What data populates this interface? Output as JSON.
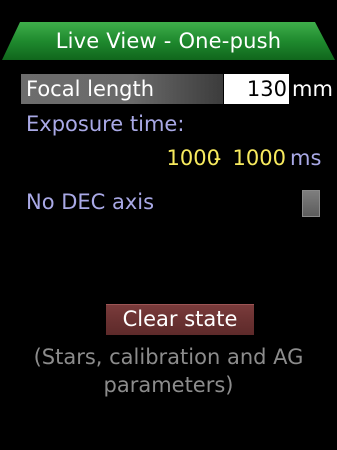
{
  "header": {
    "title": "Live View - One-push",
    "tab_color": "#1f8a2e"
  },
  "focal": {
    "label": "Focal length",
    "value": "130",
    "unit": "mm"
  },
  "exposure": {
    "label": "Exposure time:",
    "min": "1000",
    "separator": "-",
    "max": "1000",
    "unit": "ms",
    "value_color": "#f7ea5e",
    "label_color": "#a9a9e6"
  },
  "dec_axis": {
    "label": "No DEC axis",
    "checked": false
  },
  "actions": {
    "clear_label": "Clear state",
    "clear_hint_line1": "(Stars, calibration and AG",
    "clear_hint_line2": "parameters)"
  }
}
